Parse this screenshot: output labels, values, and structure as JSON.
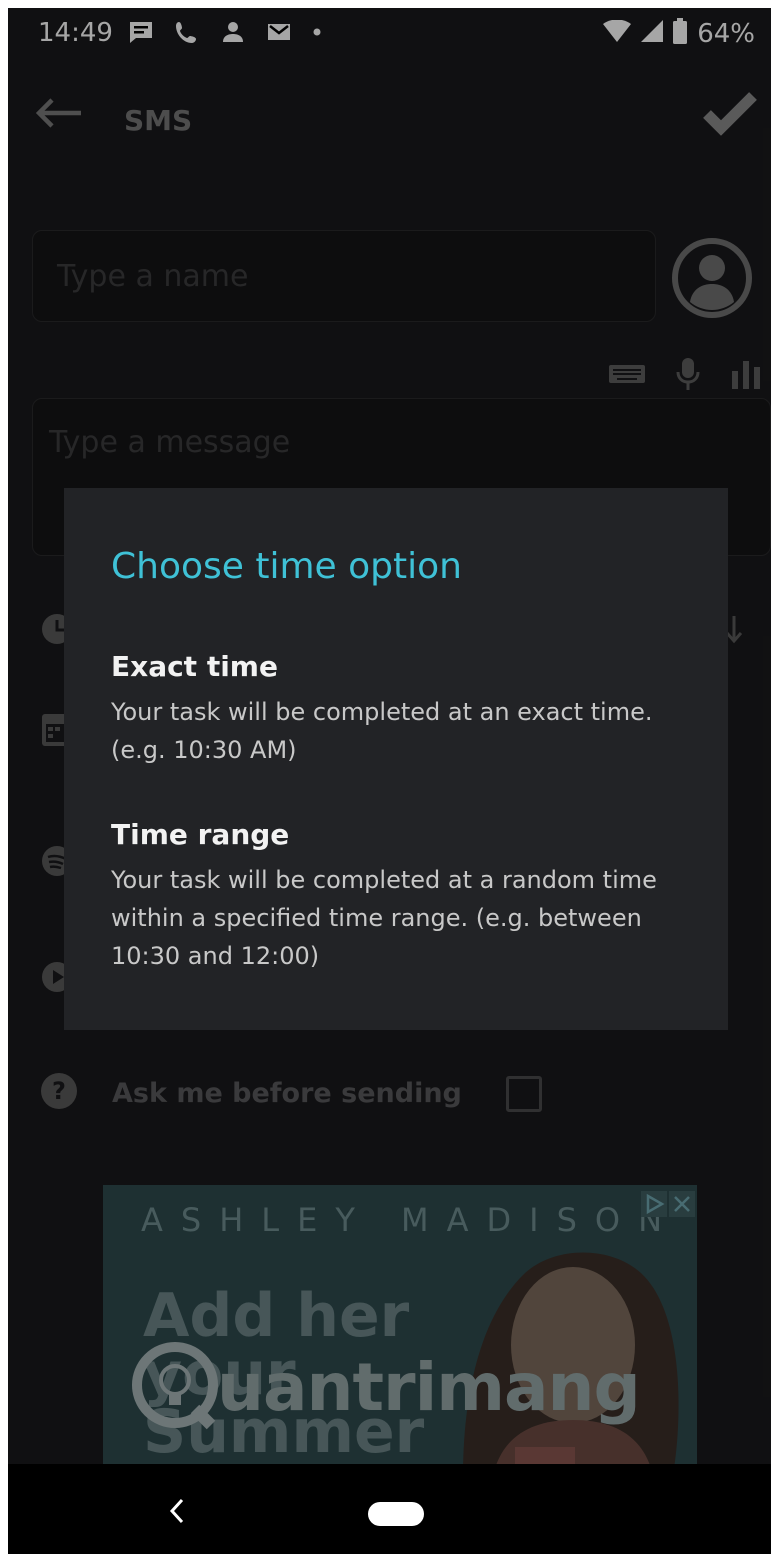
{
  "status_bar": {
    "time": "14:49",
    "battery": "64%",
    "icons": [
      "message-icon",
      "phone-icon",
      "person-icon",
      "gmail-icon",
      "dot-icon",
      "wifi-icon",
      "signal-icon",
      "battery-icon"
    ]
  },
  "app_bar": {
    "title": "SMS"
  },
  "form": {
    "name_placeholder": "Type a name",
    "message_placeholder": "Type a message",
    "ask_label": "Ask me before sending"
  },
  "ad": {
    "brand": "ASHLEY MADISON",
    "headline_1": "Add her",
    "headline_2": "your",
    "headline_3": "Summer",
    "watermark": "uantrimang"
  },
  "dialog": {
    "title": "Choose time option",
    "options": [
      {
        "title": "Exact time",
        "description": "Your task will be completed at an exact time. (e.g. 10:30 AM)"
      },
      {
        "title": "Time range",
        "description": "Your task will be completed at a random time within a specified time range. (e.g. between 10:30 and 12:00)"
      }
    ]
  },
  "colors": {
    "accent": "#3fc1d6",
    "dialog_bg": "#222326",
    "app_bg": "#1a1a1c"
  }
}
